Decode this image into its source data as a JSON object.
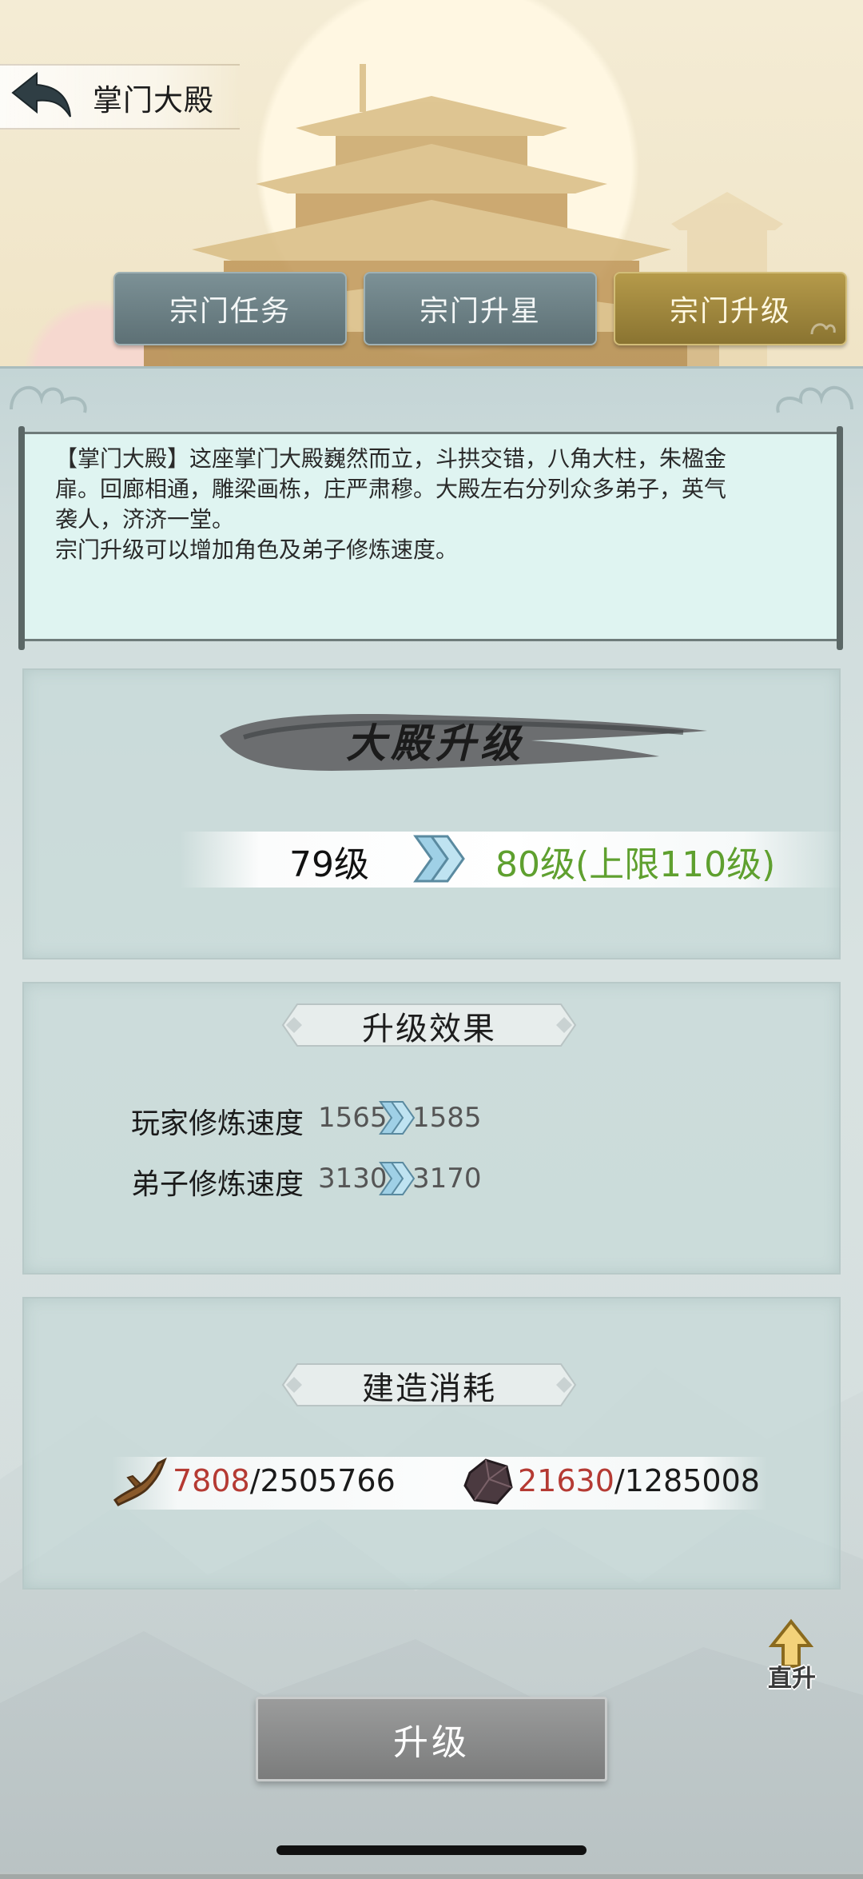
{
  "header": {
    "title": "掌门大殿"
  },
  "tabs": [
    {
      "label": "宗门任务",
      "active": false
    },
    {
      "label": "宗门升星",
      "active": false
    },
    {
      "label": "宗门升级",
      "active": true
    }
  ],
  "description": {
    "lines": [
      "【掌门大殿】这座掌门大殿巍然而立，斗拱交错，八角大柱，朱楹金",
      "扉。回廊相通，雕梁画栋，庄严肃穆。大殿左右分列众多弟子，英气",
      "袭人，济济一堂。",
      "宗门升级可以增加角色及弟子修炼速度。"
    ]
  },
  "upgrade": {
    "title": "大殿升级",
    "current_level": "79级",
    "next_level": "80级(上限110级)"
  },
  "effects": {
    "title": "升级效果",
    "rows": [
      {
        "label": "玩家修炼速度",
        "from": "1565",
        "to": "1585"
      },
      {
        "label": "弟子修炼速度",
        "from": "3130",
        "to": "3170"
      }
    ]
  },
  "cost": {
    "title": "建造消耗",
    "items": [
      {
        "icon": "wood-icon",
        "have": "7808",
        "need": "/2505766"
      },
      {
        "icon": "ore-icon",
        "have": "21630",
        "need": "/1285008"
      }
    ]
  },
  "direct_upgrade_label": "直升",
  "upgrade_button_label": "升级",
  "colors": {
    "tab_normal": "#6b7f84",
    "tab_active": "#a38a3f",
    "next_level": "#5fa02f",
    "have_insufficient": "#b53a33"
  }
}
